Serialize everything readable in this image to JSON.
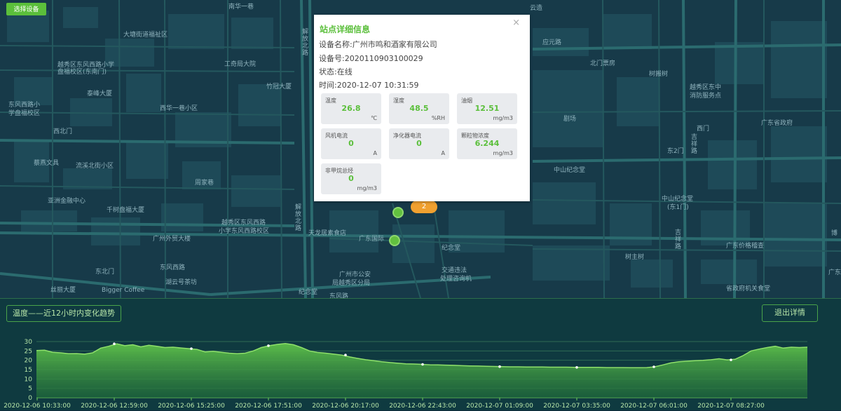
{
  "toolbar": {
    "select_device": "选择设备"
  },
  "map_labels": [
    {
      "text": "南华一巷",
      "l": 326,
      "t": 2
    },
    {
      "text": "大塘街道福祉区",
      "l": 176,
      "t": 42
    },
    {
      "text": "越秀区东风西路小学",
      "l": 82,
      "t": 85
    },
    {
      "text": "盘福校区(东南门)",
      "l": 82,
      "t": 95
    },
    {
      "text": "工奇局大院",
      "l": 320,
      "t": 84
    },
    {
      "text": "泰峰大厦",
      "l": 124,
      "t": 126
    },
    {
      "text": "竹冠大厦",
      "l": 380,
      "t": 116
    },
    {
      "text": "东风西路小",
      "l": 12,
      "t": 142
    },
    {
      "text": "学盘福校区",
      "l": 12,
      "t": 154
    },
    {
      "text": "西华一巷小区",
      "l": 228,
      "t": 147
    },
    {
      "text": "西北门",
      "l": 76,
      "t": 180
    },
    {
      "text": "蔡燕文具",
      "l": 48,
      "t": 225
    },
    {
      "text": "流溪北街小区",
      "l": 108,
      "t": 229
    },
    {
      "text": "周家巷",
      "l": 278,
      "t": 253
    },
    {
      "text": "亚洲金融中心",
      "l": 68,
      "t": 279
    },
    {
      "text": "千树盘福大厦",
      "l": 152,
      "t": 292
    },
    {
      "text": "越秀区东风西路",
      "l": 316,
      "t": 310
    },
    {
      "text": "小学东风西路校区",
      "l": 312,
      "t": 322
    },
    {
      "text": "广州外贸大楼",
      "l": 218,
      "t": 333
    },
    {
      "text": "天龙居素食店",
      "l": 440,
      "t": 325
    },
    {
      "text": "广东国际",
      "l": 512,
      "t": 333
    },
    {
      "text": "纪念堂",
      "l": 630,
      "t": 346
    },
    {
      "text": "东北门",
      "l": 136,
      "t": 380
    },
    {
      "text": "东风西路",
      "l": 228,
      "t": 374
    },
    {
      "text": "湖云号茶坊",
      "l": 236,
      "t": 395
    },
    {
      "text": "广州市公安",
      "l": 484,
      "t": 384
    },
    {
      "text": "局越秀区分局",
      "l": 474,
      "t": 396
    },
    {
      "text": "交通违法",
      "l": 630,
      "t": 378
    },
    {
      "text": "处理咨询机",
      "l": 628,
      "t": 390
    },
    {
      "text": "丝丽大厦",
      "l": 72,
      "t": 406
    },
    {
      "text": "Bigger Coffee",
      "l": 145,
      "t": 409
    },
    {
      "text": "云造",
      "l": 756,
      "t": 4
    },
    {
      "text": "应元路",
      "l": 774,
      "t": 53
    },
    {
      "text": "北门票房",
      "l": 842,
      "t": 83
    },
    {
      "text": "树搬树",
      "l": 926,
      "t": 98
    },
    {
      "text": "越秀区东中",
      "l": 984,
      "t": 117
    },
    {
      "text": "消防服务点",
      "l": 984,
      "t": 129
    },
    {
      "text": "剧场",
      "l": 804,
      "t": 162
    },
    {
      "text": "西门",
      "l": 994,
      "t": 176
    },
    {
      "text": "广东省政府",
      "l": 1086,
      "t": 168
    },
    {
      "text": "东2门",
      "l": 952,
      "t": 208
    },
    {
      "text": "中山纪念堂",
      "l": 790,
      "t": 235
    },
    {
      "text": "中山纪念堂",
      "l": 944,
      "t": 276
    },
    {
      "text": "(东1门)",
      "l": 952,
      "t": 288
    },
    {
      "text": "广东价格稽查",
      "l": 1036,
      "t": 343
    },
    {
      "text": "树主树",
      "l": 892,
      "t": 359
    },
    {
      "text": "省政府机关食堂",
      "l": 1036,
      "t": 404
    },
    {
      "text": "博",
      "l": 1186,
      "t": 325
    },
    {
      "text": "广东",
      "l": 1182,
      "t": 381
    },
    {
      "text": "纪念堂",
      "l": 426,
      "t": 409
    },
    {
      "text": "东风路",
      "l": 470,
      "t": 415
    }
  ],
  "map_labels_vertical": [
    {
      "text": "解放北路",
      "l": 428,
      "t": 40
    },
    {
      "text": "解放北路",
      "l": 418,
      "t": 290
    },
    {
      "text": "吉祥路",
      "l": 983,
      "t": 190
    },
    {
      "text": "吉祥路",
      "l": 960,
      "t": 326
    }
  ],
  "popup": {
    "title": "站点详细信息",
    "close": "×",
    "device_name": "设备名称:广州市鸣和酒家有限公司",
    "device_no": "设备号:2020110903100029",
    "status": "状态:在线",
    "time": "时间:2020-12-07 10:31:59",
    "cards": [
      {
        "label": "温度",
        "value": "26.8",
        "unit": "℃"
      },
      {
        "label": "湿度",
        "value": "48.5",
        "unit": "%RH"
      },
      {
        "label": "油烟",
        "value": "12.51",
        "unit": "mg/m3"
      },
      {
        "label": "风机电流",
        "value": "0",
        "unit": "A"
      },
      {
        "label": "净化器电流",
        "value": "0",
        "unit": "A"
      },
      {
        "label": "颗粒物浓度",
        "value": "6.244",
        "unit": "mg/m3"
      },
      {
        "label": "非甲烷总烃",
        "value": "0",
        "unit": "mg/m3"
      }
    ]
  },
  "cluster": {
    "count": "2"
  },
  "panel": {
    "chart_title": "温度——近12小时内变化趋势",
    "exit_label": "退出详情"
  },
  "colors": {
    "accent": "#5bbf3b",
    "cluster": "#f0a030",
    "line": "#7dd35a"
  },
  "chart_data": {
    "type": "area",
    "title": "温度——近12小时内变化趋势",
    "xlabel": "",
    "ylabel": "",
    "ylim": [
      0,
      30
    ],
    "yticks": [
      0,
      5,
      10,
      15,
      20,
      25,
      30
    ],
    "grid": true,
    "xtick_labels": [
      "2020-12-06 10:33:00",
      "2020-12-06 12:59:00",
      "2020-12-06 15:25:00",
      "2020-12-06 17:51:00",
      "2020-12-06 20:17:00",
      "2020-12-06 22:43:00",
      "2020-12-07 01:09:00",
      "2020-12-07 03:35:00",
      "2020-12-07 06:01:00",
      "2020-12-07 08:27:00"
    ],
    "series": [
      {
        "values": [
          25.2,
          25.4,
          24.3,
          24.0,
          23.5,
          23.6,
          23.3,
          24.0,
          26.5,
          27.5,
          28.8,
          27.8,
          28.3,
          27.2,
          28.0,
          27.5,
          26.8,
          27.0,
          26.6,
          26.2,
          25.8,
          24.5,
          24.8,
          24.3,
          23.8,
          23.5,
          23.8,
          25.0,
          26.8,
          27.8,
          28.5,
          29.0,
          28.3,
          26.8,
          25.0,
          24.2,
          23.8,
          23.3,
          22.8,
          21.8,
          21.0,
          20.3,
          19.8,
          19.2,
          18.8,
          18.4,
          18.1,
          18.0,
          17.8,
          17.6,
          17.5,
          17.4,
          17.3,
          17.1,
          17.0,
          16.9,
          16.8,
          16.7,
          16.6,
          16.5,
          16.5,
          16.4,
          16.4,
          16.4,
          16.3,
          16.3,
          16.3,
          16.2,
          16.2,
          16.2,
          16.2,
          16.1,
          16.1,
          16.1,
          16.0,
          16.0,
          16.1,
          16.5,
          17.5,
          18.6,
          19.2,
          19.5,
          19.8,
          20.0,
          20.3,
          20.8,
          20.2,
          20.5,
          22.5,
          25.0,
          26.0,
          26.8,
          27.5,
          26.5,
          27.0,
          26.8,
          27.0
        ]
      }
    ]
  }
}
